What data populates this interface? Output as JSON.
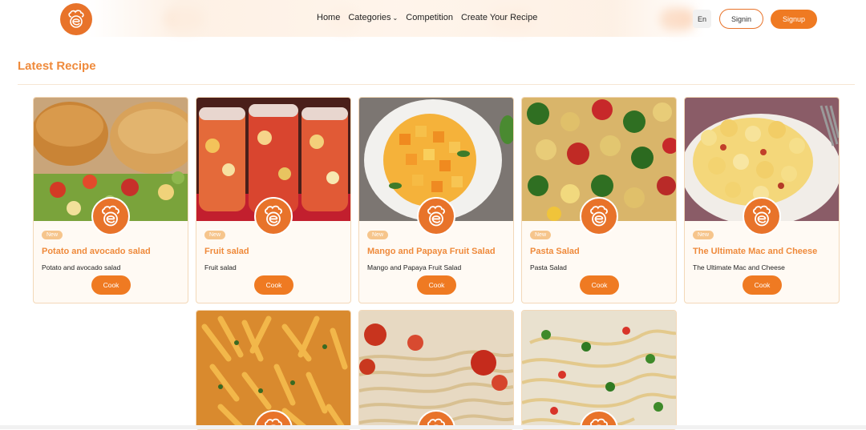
{
  "header": {
    "logo_icon": "chef-hat-logo-icon",
    "nav": [
      {
        "label": "Home"
      },
      {
        "label": "Categories"
      },
      {
        "label": "Competition"
      },
      {
        "label": "Create Your Recipe"
      }
    ],
    "lang_label": "En",
    "signin_label": "Signin",
    "signup_label": "Signup"
  },
  "section": {
    "title": "Latest Recipe"
  },
  "cards": [
    {
      "badge": "New",
      "title": "Potato and avocado salad",
      "desc": "Potato and avocado salad",
      "cook_label": "Cook"
    },
    {
      "badge": "New",
      "title": "Fruit salad",
      "desc": "Fruit salad",
      "cook_label": "Cook"
    },
    {
      "badge": "New",
      "title": "Mango and Papaya Fruit Salad",
      "desc": "Mango and Papaya Fruit Salad",
      "cook_label": "Cook"
    },
    {
      "badge": "New",
      "title": "Pasta Salad",
      "desc": "Pasta Salad",
      "cook_label": "Cook"
    },
    {
      "badge": "New",
      "title": "The Ultimate Mac and Cheese",
      "desc": "The Ultimate Mac and Cheese",
      "cook_label": "Cook"
    }
  ],
  "colors": {
    "accent": "#ef7a22",
    "title": "#ef8a3b",
    "card_border": "#f3d8b8"
  }
}
